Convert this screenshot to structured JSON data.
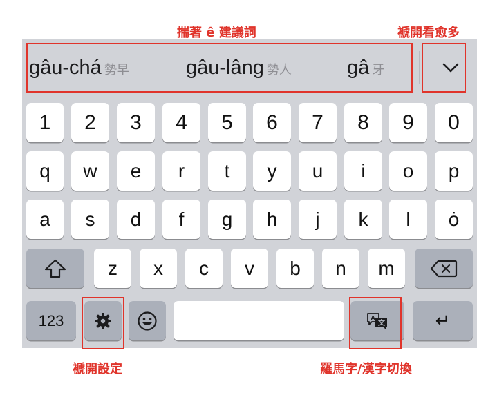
{
  "annotations": {
    "candidates": "揣著 ê 建議詞",
    "expand": "褫開看愈多",
    "settings": "褫開設定",
    "switch": "羅馬字/漢字切換"
  },
  "candidates": [
    {
      "romanization": "gâu-chá",
      "hanji": "勢早"
    },
    {
      "romanization": "gâu-lâng",
      "hanji": "勢人"
    },
    {
      "romanization": "gâ",
      "hanji": "牙"
    }
  ],
  "keys": {
    "numbers": [
      "1",
      "2",
      "3",
      "4",
      "5",
      "6",
      "7",
      "8",
      "9",
      "0"
    ],
    "row1": [
      "q",
      "w",
      "e",
      "r",
      "t",
      "y",
      "u",
      "i",
      "o",
      "p"
    ],
    "row2": [
      "a",
      "s",
      "d",
      "f",
      "g",
      "h",
      "j",
      "k",
      "l",
      "ȯ"
    ],
    "row3": [
      "z",
      "x",
      "c",
      "v",
      "b",
      "n",
      "m"
    ],
    "numeric_mode": "123",
    "space": "",
    "return_symbol": "↵"
  },
  "icons": {
    "expand": "chevron-down-icon",
    "shift": "shift-icon",
    "backspace": "backspace-icon",
    "settings": "gear-icon",
    "emoji": "emoji-icon",
    "switch": "language-switch-icon",
    "return": "return-icon"
  },
  "colors": {
    "annotation_red": "#e0342b",
    "keyboard_bg": "#d1d3d8",
    "key_bg": "#ffffff",
    "function_key_bg": "#abb0ba"
  }
}
